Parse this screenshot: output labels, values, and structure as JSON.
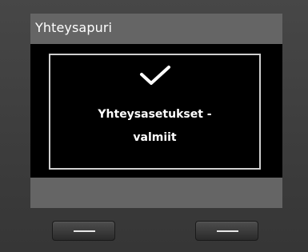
{
  "header": {
    "title": "Yhteysapuri"
  },
  "dialog": {
    "icon": "checkmark-icon",
    "message_line1": "Yhteysasetukset -",
    "message_line2": "valmiit"
  },
  "softkeys": {
    "left_icon": "dash-icon",
    "right_icon": "dash-icon"
  },
  "colors": {
    "bezel": "#3c3c3c",
    "title_bar": "#656565",
    "screen_bg": "#000000",
    "text": "#ffffff",
    "dialog_border": "#cfcfcf"
  }
}
